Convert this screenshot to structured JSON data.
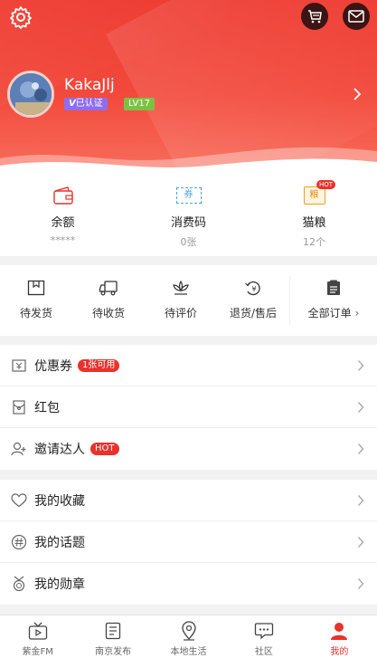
{
  "profile": {
    "username": "KakaJlj",
    "verified_label": "已认证",
    "level_label": "LV17"
  },
  "wallet": [
    {
      "icon": "wallet-icon",
      "title": "余额",
      "value": "*****"
    },
    {
      "icon": "voucher-icon",
      "icon_text": "券",
      "title": "消费码",
      "value": "0张"
    },
    {
      "icon": "cat-food-icon",
      "icon_text": "粮",
      "hot": "HOT",
      "title": "猫粮",
      "value": "12个"
    }
  ],
  "orders": {
    "items": [
      {
        "icon": "pending-shipment-icon",
        "label": "待发货"
      },
      {
        "icon": "truck-icon",
        "label": "待收货"
      },
      {
        "icon": "review-flower-icon",
        "label": "待评价"
      },
      {
        "icon": "refund-icon",
        "label": "退货/售后"
      }
    ],
    "all": {
      "icon": "order-list-icon",
      "label": "全部订单"
    }
  },
  "menu_group1": [
    {
      "icon": "coupon-icon",
      "label": "优惠券",
      "tag": "1张可用"
    },
    {
      "icon": "red-packet-icon",
      "label": "红包"
    },
    {
      "icon": "invite-user-icon",
      "label": "邀请达人",
      "tag": "HOT"
    }
  ],
  "menu_group2": [
    {
      "icon": "heart-icon",
      "label": "我的收藏"
    },
    {
      "icon": "hashtag-icon",
      "label": "我的话题"
    },
    {
      "icon": "medal-icon",
      "label": "我的勋章"
    }
  ],
  "tabbar": [
    {
      "icon": "tv-icon",
      "label": "紫金FM"
    },
    {
      "icon": "document-icon",
      "label": "南京发布"
    },
    {
      "icon": "location-pin-icon",
      "label": "本地生活"
    },
    {
      "icon": "chat-bubble-icon",
      "label": "社区"
    },
    {
      "icon": "person-icon",
      "label": "我的",
      "active": true
    }
  ],
  "colors": {
    "brand_red": "#e8322c",
    "verified_purple": "#8f6df0",
    "level_green": "#7cc242"
  }
}
